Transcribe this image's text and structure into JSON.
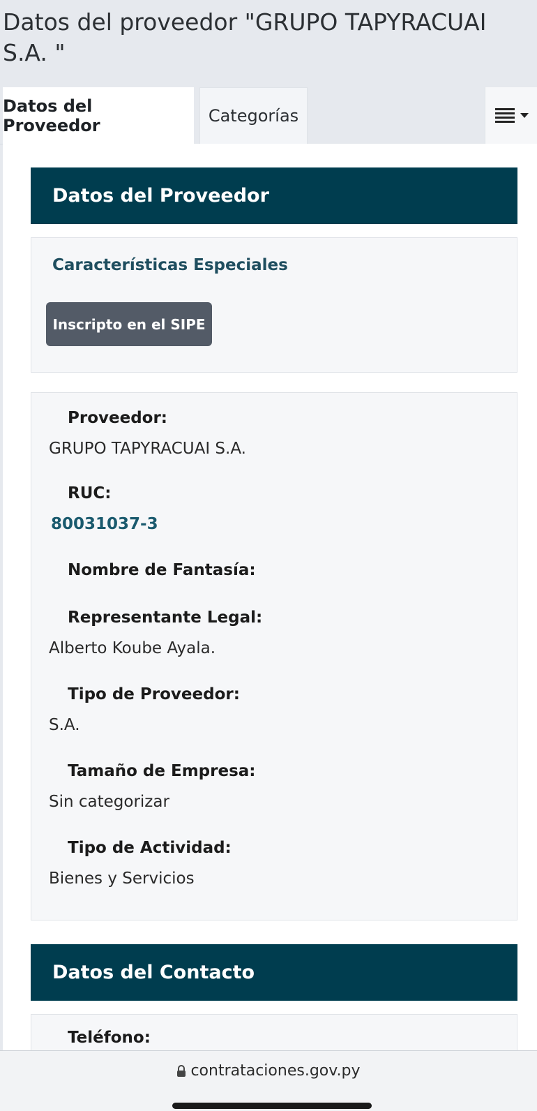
{
  "page": {
    "title": "Datos del proveedor \"GRUPO TAPYRACUAI S.A. \""
  },
  "tabs": [
    {
      "label": "Datos del Proveedor",
      "active": true
    },
    {
      "label": "Categorías",
      "active": false
    }
  ],
  "tab_menu": {
    "icon": "hamburger-list-icon",
    "caret_icon": "caret-down-icon"
  },
  "provider_section": {
    "header": "Datos del Proveedor",
    "special_title": "Características Especiales",
    "badge": "Inscripto en el SIPE",
    "fields": [
      {
        "label": "Proveedor:",
        "value": "GRUPO TAPYRACUAI S.A."
      },
      {
        "label": "RUC:",
        "value": "80031037-3"
      },
      {
        "label": "Nombre de Fantasía:",
        "value": ""
      },
      {
        "label": "Representante Legal:",
        "value": "Alberto Koube Ayala."
      },
      {
        "label": "Tipo de Proveedor:",
        "value": "S.A."
      },
      {
        "label": "Tamaño de Empresa:",
        "value": "Sin categorizar"
      },
      {
        "label": "Tipo de Actividad:",
        "value": "Bienes y Servicios"
      }
    ]
  },
  "contact_section": {
    "header": "Datos del Contacto",
    "fields": [
      {
        "label": "Teléfono:",
        "value": ""
      }
    ]
  },
  "browser": {
    "url": "contrataciones.gov.py",
    "lock_icon": "lock-icon"
  },
  "colors": {
    "header_bg": "#003d4f",
    "badge_bg": "#535b67",
    "link": "#1a5a6e",
    "page_bg": "#e6e9ee"
  }
}
